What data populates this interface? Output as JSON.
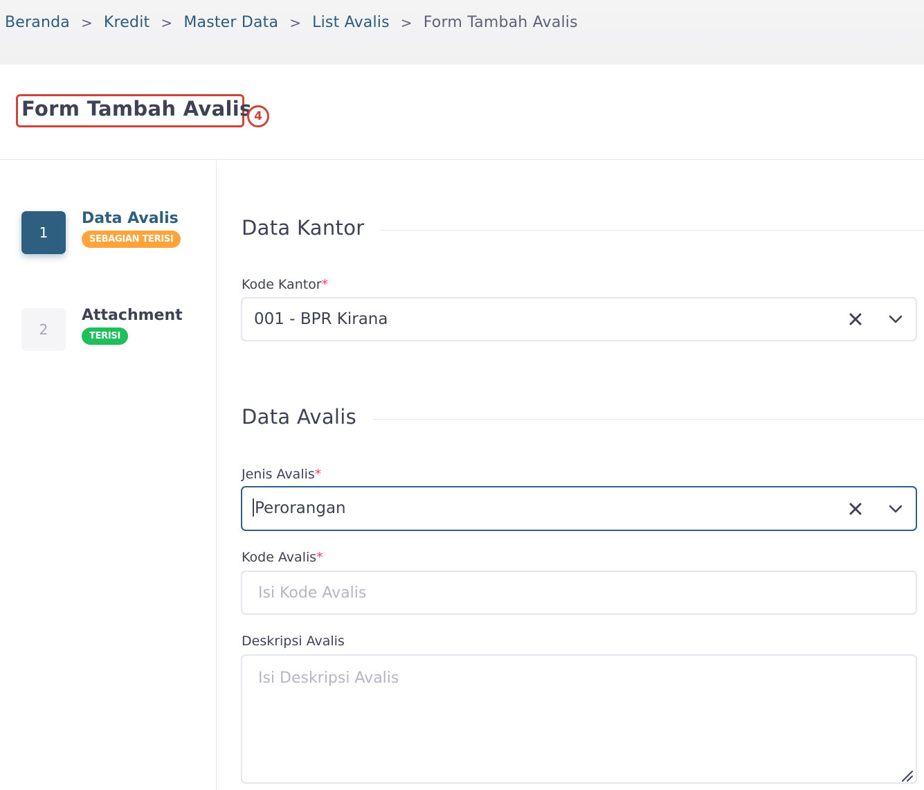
{
  "breadcrumb": {
    "items": [
      {
        "label": "Beranda"
      },
      {
        "label": "Kredit"
      },
      {
        "label": "Master Data"
      },
      {
        "label": "List Avalis"
      }
    ],
    "current": "Form Tambah Avalis",
    "separator": ">"
  },
  "page": {
    "title": "Form Tambah Avalis",
    "annotation_number": "4"
  },
  "stepper": {
    "steps": [
      {
        "number": "1",
        "title": "Data Avalis",
        "status": "SEBAGIAN TERISI",
        "active": true,
        "status_color": "#ffa43b"
      },
      {
        "number": "2",
        "title": "Attachment",
        "status": "TERISI",
        "active": false,
        "status_color": "#1fbf5b"
      }
    ]
  },
  "sections": {
    "kantor": {
      "title": "Data Kantor",
      "kode_kantor": {
        "label": "Kode Kantor",
        "required_mark": "*",
        "value": "001 - BPR Kirana"
      }
    },
    "avalis": {
      "title": "Data Avalis",
      "jenis_avalis": {
        "label": "Jenis Avalis",
        "required_mark": "*",
        "value": "Perorangan"
      },
      "kode_avalis": {
        "label": "Kode Avalis",
        "required_mark": "*",
        "value": "",
        "placeholder": "Isi Kode Avalis"
      },
      "deskripsi_avalis": {
        "label": "Deskripsi Avalis",
        "value": "",
        "placeholder": "Isi Deskripsi Avalis"
      }
    }
  },
  "icons": {
    "clear": "close-icon",
    "dropdown": "chevron-down-icon",
    "resize": "resize-grip-icon"
  },
  "colors": {
    "primary": "#2e5f80",
    "annotation": "#d0453a",
    "required": "#f1416c",
    "warning": "#ffa43b",
    "success": "#1fbf5b"
  }
}
